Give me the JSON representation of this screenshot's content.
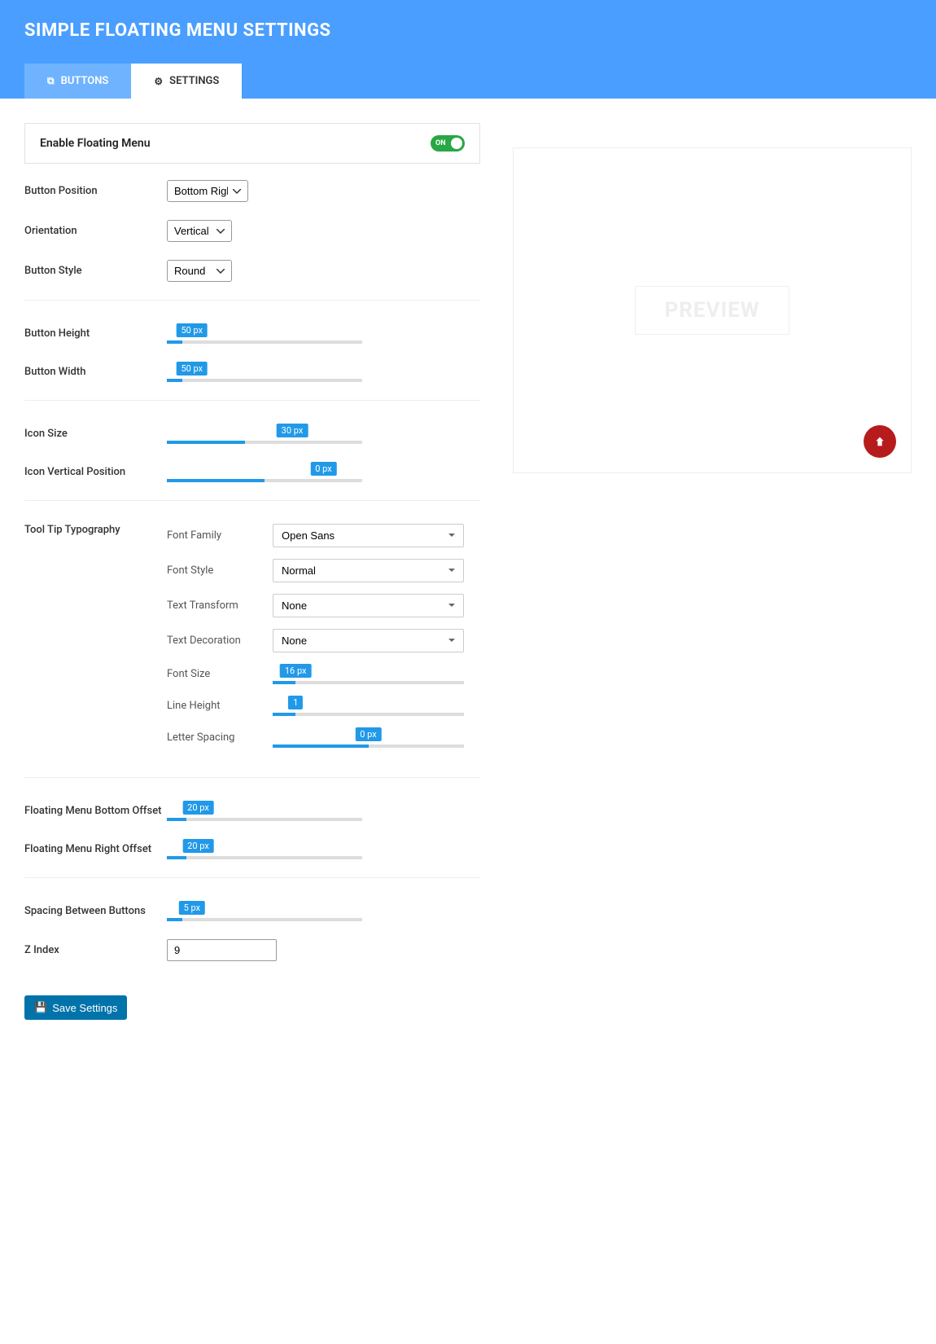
{
  "header": {
    "title": "SIMPLE FLOATING MENU SETTINGS",
    "tabs": {
      "buttons": "BUTTONS",
      "settings": "SETTINGS"
    }
  },
  "enable": {
    "label": "Enable Floating Menu",
    "state": "ON"
  },
  "rows": {
    "button_position": {
      "label": "Button Position",
      "value": "Bottom Right"
    },
    "orientation": {
      "label": "Orientation",
      "value": "Vertical"
    },
    "button_style": {
      "label": "Button Style",
      "value": "Round"
    },
    "button_height": {
      "label": "Button Height",
      "value": "50 px",
      "pct": 8
    },
    "button_width": {
      "label": "Button Width",
      "value": "50 px",
      "pct": 8
    },
    "icon_size": {
      "label": "Icon Size",
      "value": "30 px",
      "pct": 40
    },
    "icon_vpos": {
      "label": "Icon Vertical Position",
      "value": "0 px",
      "pct": 50
    },
    "bottom_offset": {
      "label": "Floating Menu Bottom Offset",
      "value": "20 px",
      "pct": 10
    },
    "right_offset": {
      "label": "Floating Menu Right Offset",
      "value": "20 px",
      "pct": 10
    },
    "spacing": {
      "label": "Spacing Between Buttons",
      "value": "5 px",
      "pct": 8
    },
    "zindex": {
      "label": "Z Index",
      "value": "9"
    }
  },
  "typo": {
    "title": "Tool Tip Typography",
    "font_family": {
      "label": "Font Family",
      "value": "Open Sans"
    },
    "font_style": {
      "label": "Font Style",
      "value": "Normal"
    },
    "text_transform": {
      "label": "Text Transform",
      "value": "None"
    },
    "text_decoration": {
      "label": "Text Decoration",
      "value": "None"
    },
    "font_size": {
      "label": "Font Size",
      "value": "16 px",
      "pct": 12
    },
    "line_height": {
      "label": "Line Height",
      "value": "1",
      "pct": 12
    },
    "letter_spacing": {
      "label": "Letter Spacing",
      "value": "0 px",
      "pct": 50
    }
  },
  "save": "Save Settings",
  "preview": {
    "label": "PREVIEW"
  }
}
